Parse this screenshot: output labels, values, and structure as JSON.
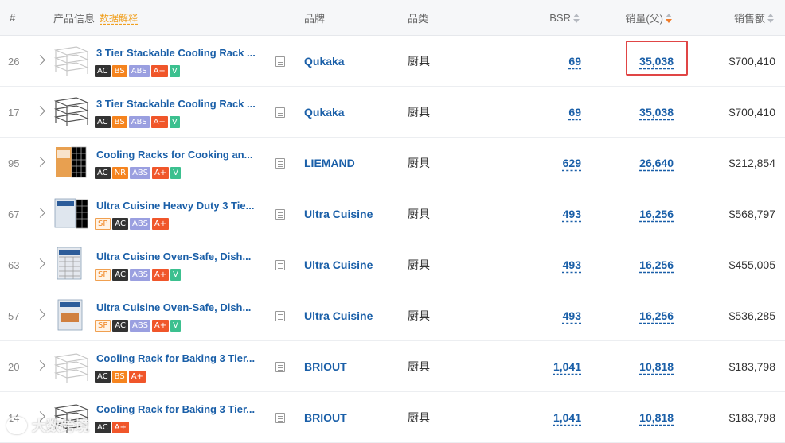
{
  "header": {
    "num": "#",
    "product": "产品信息",
    "product_link": "数据解释",
    "brand": "品牌",
    "category": "品类",
    "bsr": "BSR",
    "sales": "销量(父)",
    "revenue": "销售额"
  },
  "rows": [
    {
      "idx": "26",
      "title": "3 Tier Stackable Cooling Rack ...",
      "brand": "Qukaka",
      "category": "厨具",
      "bsr": "69",
      "sales": "35,038",
      "revenue": "$700,410"
    },
    {
      "idx": "17",
      "title": "3 Tier Stackable Cooling Rack ...",
      "brand": "Qukaka",
      "category": "厨具",
      "bsr": "69",
      "sales": "35,038",
      "revenue": "$700,410"
    },
    {
      "idx": "95",
      "title": "Cooling Racks for Cooking an...",
      "brand": "LIEMAND",
      "category": "厨具",
      "bsr": "629",
      "sales": "26,640",
      "revenue": "$212,854"
    },
    {
      "idx": "67",
      "title": "Ultra Cuisine Heavy Duty 3 Tie...",
      "brand": "Ultra Cuisine",
      "category": "厨具",
      "bsr": "493",
      "sales": "16,256",
      "revenue": "$568,797"
    },
    {
      "idx": "63",
      "title": "Ultra Cuisine Oven-Safe, Dish...",
      "brand": "Ultra Cuisine",
      "category": "厨具",
      "bsr": "493",
      "sales": "16,256",
      "revenue": "$455,005"
    },
    {
      "idx": "57",
      "title": "Ultra Cuisine Oven-Safe, Dish...",
      "brand": "Ultra Cuisine",
      "category": "厨具",
      "bsr": "493",
      "sales": "16,256",
      "revenue": "$536,285"
    },
    {
      "idx": "20",
      "title": "Cooling Rack for Baking 3 Tier...",
      "brand": "BRIOUT",
      "category": "厨具",
      "bsr": "1,041",
      "sales": "10,818",
      "revenue": "$183,798"
    },
    {
      "idx": "14",
      "title": "Cooling Rack for Baking 3 Tier...",
      "brand": "BRIOUT",
      "category": "厨具",
      "bsr": "1,041",
      "sales": "10,818",
      "revenue": "$183,798"
    }
  ],
  "tags": {
    "ac": "AC",
    "bs": "BS",
    "nr": "NR",
    "abs": "ABS",
    "aplus": "A+",
    "v": "V",
    "sp": "SP"
  },
  "watermark": "大数跨境"
}
